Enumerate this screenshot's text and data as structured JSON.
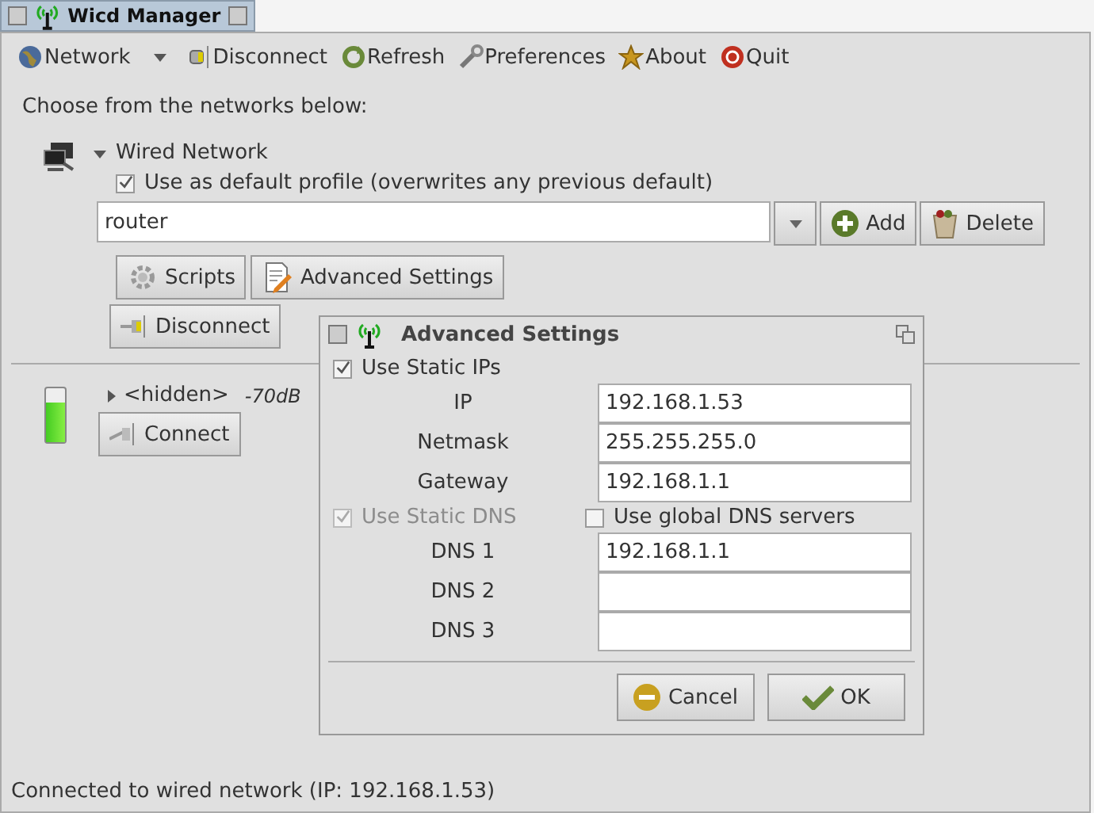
{
  "window": {
    "title": "Wicd Manager"
  },
  "toolbar": [
    {
      "label": "Network",
      "kind": "globe",
      "dropdown": true
    },
    {
      "label": "Disconnect",
      "kind": "plug",
      "dropdown": false
    },
    {
      "label": "Refresh",
      "kind": "refresh",
      "dropdown": false
    },
    {
      "label": "Preferences",
      "kind": "wrench",
      "dropdown": false
    },
    {
      "label": "About",
      "kind": "star",
      "dropdown": false
    },
    {
      "label": "Quit",
      "kind": "quit",
      "dropdown": false
    }
  ],
  "prompt": "Choose from the networks below:",
  "wired": {
    "name": "Wired Network",
    "expanded": true,
    "default_profile": {
      "label": "Use as default profile (overwrites any previous default)",
      "checked": true
    },
    "profile": "router",
    "add": "Add",
    "delete": "Delete",
    "scripts": "Scripts",
    "advanced": "Advanced Settings",
    "disconnect": "Disconnect"
  },
  "wireless": [
    {
      "name": "<hidden>",
      "expanded": false,
      "signal": "-70dB",
      "connect": "Connect",
      "level": 0.75
    }
  ],
  "dialog": {
    "title": "Advanced Settings",
    "static_ips": {
      "label": "Use Static IPs",
      "checked": true,
      "disabled": false
    },
    "ip_fields": [
      {
        "label": "IP",
        "value": "192.168.1.53"
      },
      {
        "label": "Netmask",
        "value": "255.255.255.0"
      },
      {
        "label": "Gateway",
        "value": "192.168.1.1"
      }
    ],
    "static_dns": {
      "label": "Use Static DNS",
      "checked": true,
      "disabled": true
    },
    "global_dns": {
      "label": "Use global DNS servers",
      "checked": false,
      "disabled": false
    },
    "dns_fields": [
      {
        "label": "DNS 1",
        "value": "192.168.1.1"
      },
      {
        "label": "DNS 2"
      },
      {
        "label": "DNS 3"
      }
    ],
    "buttons": [
      {
        "label": "Cancel",
        "kind": "cancel"
      },
      {
        "label": "OK",
        "kind": "ok"
      }
    ]
  },
  "status_bar": "Connected to wired network (IP: 192.168.1.53)"
}
